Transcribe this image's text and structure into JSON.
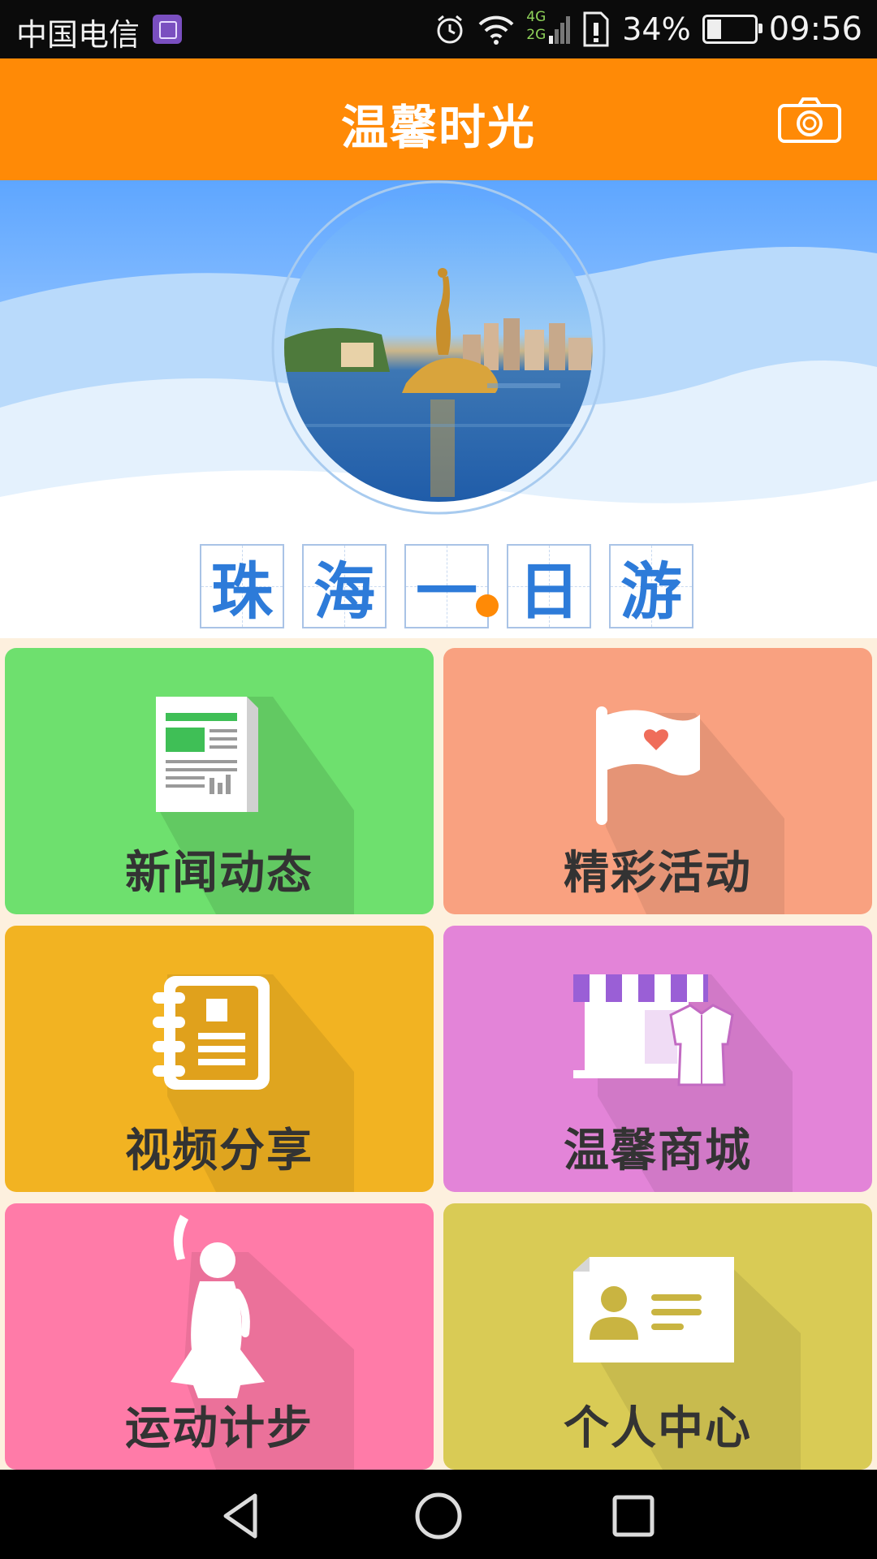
{
  "status_bar": {
    "carrier": "中国电信",
    "network": "4G 2G",
    "battery": "34%",
    "battery_level": 0.34,
    "time": "09:56"
  },
  "header": {
    "title": "温馨时光",
    "camera_icon": "camera-icon",
    "color": "#ff8a06"
  },
  "banner": {
    "caption_chars": [
      "珠",
      "海",
      "一",
      "日",
      "游"
    ]
  },
  "tiles": [
    {
      "label": "新闻动态",
      "icon": "newspaper-icon",
      "color": "#6ee06e"
    },
    {
      "label": "精彩活动",
      "icon": "flag-icon",
      "color": "#f9a180"
    },
    {
      "label": "视频分享",
      "icon": "notebook-icon",
      "color": "#f2b322"
    },
    {
      "label": "温馨商城",
      "icon": "shop-icon",
      "color": "#e384d8"
    },
    {
      "label": "运动计步",
      "icon": "dancer-icon",
      "color": "#ff7ba8"
    },
    {
      "label": "个人中心",
      "icon": "id-card-icon",
      "color": "#d9cb55"
    }
  ],
  "nav": {
    "back_icon": "back-icon",
    "home_icon": "home-icon",
    "recents_icon": "recents-icon"
  }
}
